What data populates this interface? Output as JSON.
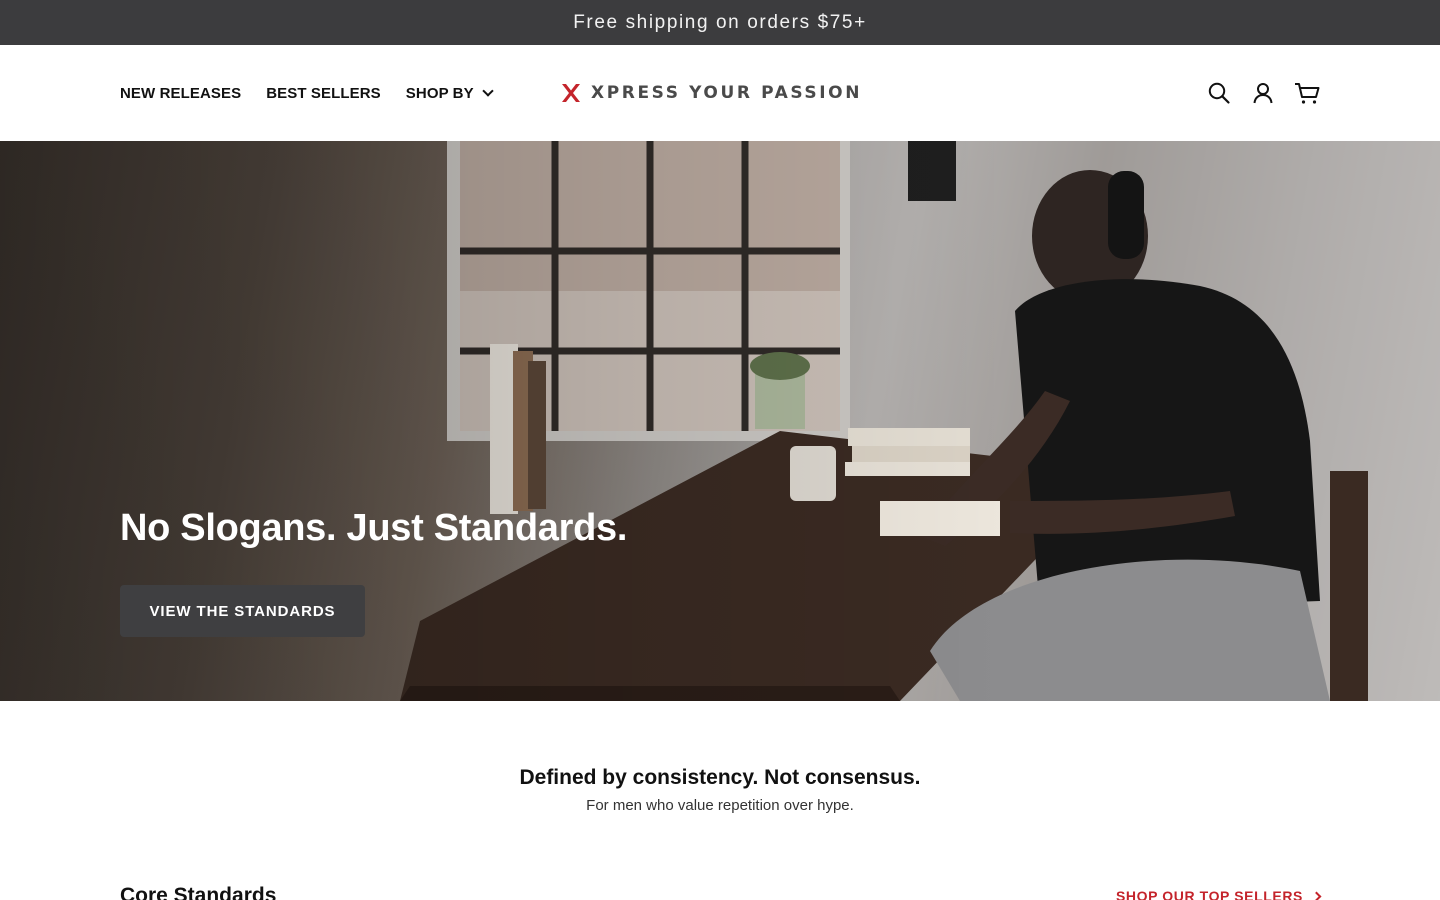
{
  "announcement": {
    "text": "Free shipping on orders $75+"
  },
  "header": {
    "nav": {
      "new_releases": "NEW RELEASES",
      "best_sellers": "BEST SELLERS",
      "shop_by": "SHOP BY"
    },
    "logo": {
      "text": "XPRESS YOUR PASSION",
      "mark_color": "#c4242b"
    },
    "icons": [
      "search-icon",
      "account-icon",
      "cart-icon"
    ]
  },
  "hero": {
    "title": "No Slogans. Just Standards.",
    "cta_label": "VIEW THE STANDARDS"
  },
  "intro": {
    "title": "Defined by consistency. Not consensus.",
    "subtitle": "For men who value repetition over hype."
  },
  "core_section": {
    "title": "Core Standards",
    "link_label": "SHOP OUR TOP SELLERS"
  },
  "colors": {
    "announcement_bg": "#3c3c3e",
    "button_bg": "#3f3f41",
    "accent_red": "#c4242b"
  }
}
